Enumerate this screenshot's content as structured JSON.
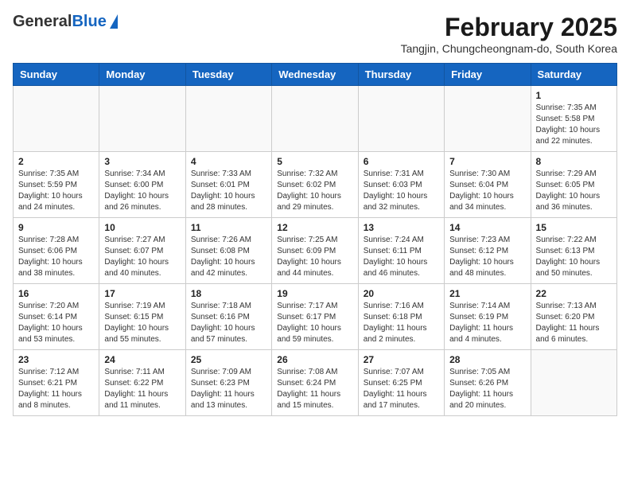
{
  "header": {
    "logo": {
      "general": "General",
      "blue": "Blue"
    },
    "title": "February 2025",
    "location": "Tangjin, Chungcheongnam-do, South Korea"
  },
  "weekdays": [
    "Sunday",
    "Monday",
    "Tuesday",
    "Wednesday",
    "Thursday",
    "Friday",
    "Saturday"
  ],
  "weeks": [
    [
      {
        "day": "",
        "info": ""
      },
      {
        "day": "",
        "info": ""
      },
      {
        "day": "",
        "info": ""
      },
      {
        "day": "",
        "info": ""
      },
      {
        "day": "",
        "info": ""
      },
      {
        "day": "",
        "info": ""
      },
      {
        "day": "1",
        "info": "Sunrise: 7:35 AM\nSunset: 5:58 PM\nDaylight: 10 hours\nand 22 minutes."
      }
    ],
    [
      {
        "day": "2",
        "info": "Sunrise: 7:35 AM\nSunset: 5:59 PM\nDaylight: 10 hours\nand 24 minutes."
      },
      {
        "day": "3",
        "info": "Sunrise: 7:34 AM\nSunset: 6:00 PM\nDaylight: 10 hours\nand 26 minutes."
      },
      {
        "day": "4",
        "info": "Sunrise: 7:33 AM\nSunset: 6:01 PM\nDaylight: 10 hours\nand 28 minutes."
      },
      {
        "day": "5",
        "info": "Sunrise: 7:32 AM\nSunset: 6:02 PM\nDaylight: 10 hours\nand 29 minutes."
      },
      {
        "day": "6",
        "info": "Sunrise: 7:31 AM\nSunset: 6:03 PM\nDaylight: 10 hours\nand 32 minutes."
      },
      {
        "day": "7",
        "info": "Sunrise: 7:30 AM\nSunset: 6:04 PM\nDaylight: 10 hours\nand 34 minutes."
      },
      {
        "day": "8",
        "info": "Sunrise: 7:29 AM\nSunset: 6:05 PM\nDaylight: 10 hours\nand 36 minutes."
      }
    ],
    [
      {
        "day": "9",
        "info": "Sunrise: 7:28 AM\nSunset: 6:06 PM\nDaylight: 10 hours\nand 38 minutes."
      },
      {
        "day": "10",
        "info": "Sunrise: 7:27 AM\nSunset: 6:07 PM\nDaylight: 10 hours\nand 40 minutes."
      },
      {
        "day": "11",
        "info": "Sunrise: 7:26 AM\nSunset: 6:08 PM\nDaylight: 10 hours\nand 42 minutes."
      },
      {
        "day": "12",
        "info": "Sunrise: 7:25 AM\nSunset: 6:09 PM\nDaylight: 10 hours\nand 44 minutes."
      },
      {
        "day": "13",
        "info": "Sunrise: 7:24 AM\nSunset: 6:11 PM\nDaylight: 10 hours\nand 46 minutes."
      },
      {
        "day": "14",
        "info": "Sunrise: 7:23 AM\nSunset: 6:12 PM\nDaylight: 10 hours\nand 48 minutes."
      },
      {
        "day": "15",
        "info": "Sunrise: 7:22 AM\nSunset: 6:13 PM\nDaylight: 10 hours\nand 50 minutes."
      }
    ],
    [
      {
        "day": "16",
        "info": "Sunrise: 7:20 AM\nSunset: 6:14 PM\nDaylight: 10 hours\nand 53 minutes."
      },
      {
        "day": "17",
        "info": "Sunrise: 7:19 AM\nSunset: 6:15 PM\nDaylight: 10 hours\nand 55 minutes."
      },
      {
        "day": "18",
        "info": "Sunrise: 7:18 AM\nSunset: 6:16 PM\nDaylight: 10 hours\nand 57 minutes."
      },
      {
        "day": "19",
        "info": "Sunrise: 7:17 AM\nSunset: 6:17 PM\nDaylight: 10 hours\nand 59 minutes."
      },
      {
        "day": "20",
        "info": "Sunrise: 7:16 AM\nSunset: 6:18 PM\nDaylight: 11 hours\nand 2 minutes."
      },
      {
        "day": "21",
        "info": "Sunrise: 7:14 AM\nSunset: 6:19 PM\nDaylight: 11 hours\nand 4 minutes."
      },
      {
        "day": "22",
        "info": "Sunrise: 7:13 AM\nSunset: 6:20 PM\nDaylight: 11 hours\nand 6 minutes."
      }
    ],
    [
      {
        "day": "23",
        "info": "Sunrise: 7:12 AM\nSunset: 6:21 PM\nDaylight: 11 hours\nand 8 minutes."
      },
      {
        "day": "24",
        "info": "Sunrise: 7:11 AM\nSunset: 6:22 PM\nDaylight: 11 hours\nand 11 minutes."
      },
      {
        "day": "25",
        "info": "Sunrise: 7:09 AM\nSunset: 6:23 PM\nDaylight: 11 hours\nand 13 minutes."
      },
      {
        "day": "26",
        "info": "Sunrise: 7:08 AM\nSunset: 6:24 PM\nDaylight: 11 hours\nand 15 minutes."
      },
      {
        "day": "27",
        "info": "Sunrise: 7:07 AM\nSunset: 6:25 PM\nDaylight: 11 hours\nand 17 minutes."
      },
      {
        "day": "28",
        "info": "Sunrise: 7:05 AM\nSunset: 6:26 PM\nDaylight: 11 hours\nand 20 minutes."
      },
      {
        "day": "",
        "info": ""
      }
    ]
  ]
}
